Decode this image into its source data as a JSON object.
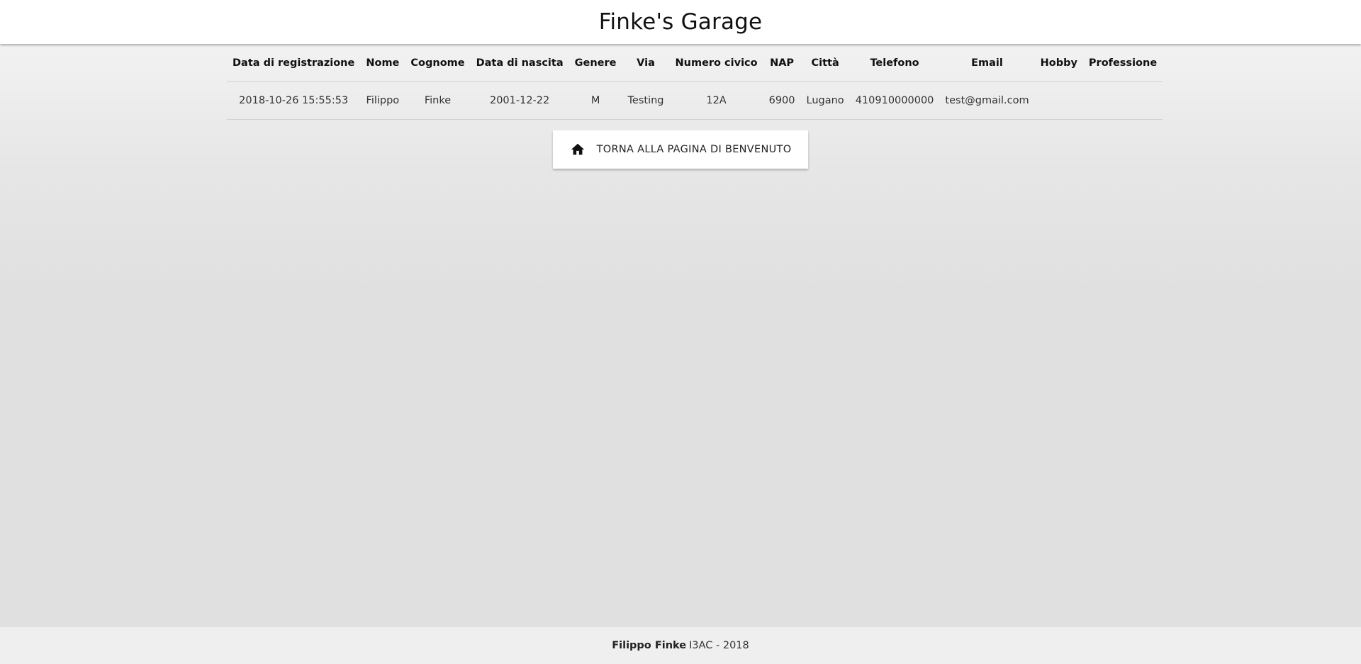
{
  "header": {
    "title": "Finke's Garage"
  },
  "table": {
    "columns": [
      "Data di registrazione",
      "Nome",
      "Cognome",
      "Data di nascita",
      "Genere",
      "Via",
      "Numero civico",
      "NAP",
      "Città",
      "Telefono",
      "Email",
      "Hobby",
      "Professione"
    ],
    "rows": [
      [
        "2018-10-26 15:55:53",
        "Filippo",
        "Finke",
        "2001-12-22",
        "M",
        "Testing",
        "12A",
        "6900",
        "Lugano",
        "410910000000",
        "test@gmail.com",
        "",
        ""
      ]
    ]
  },
  "home_button": {
    "icon": "home-icon",
    "label": "TORNA ALLA PAGINA DI BENVENUTO"
  },
  "footer": {
    "author": "Filippo Finke",
    "class_year": "I3AC - 2018"
  }
}
